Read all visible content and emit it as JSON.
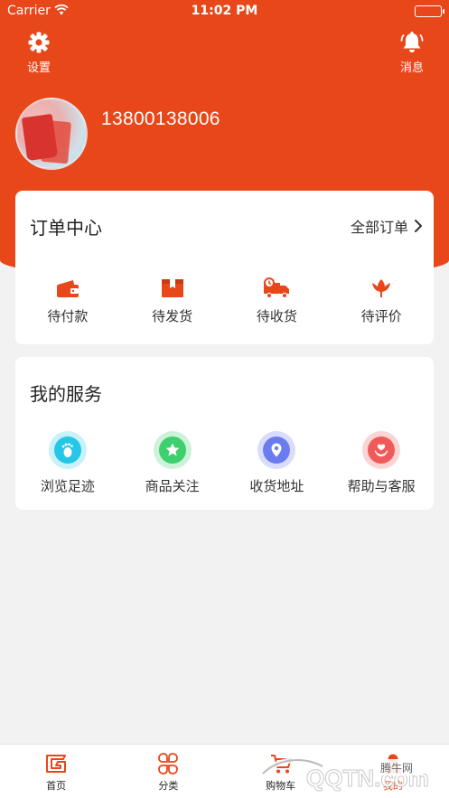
{
  "status_bar": {
    "carrier": "Carrier",
    "time": "11:02 PM"
  },
  "header": {
    "settings_label": "设置",
    "messages_label": "消息",
    "phone": "13800138006"
  },
  "orders": {
    "title": "订单中心",
    "all_orders": "全部订单",
    "items": [
      {
        "label": "待付款",
        "icon": "wallet-icon"
      },
      {
        "label": "待发货",
        "icon": "package-icon"
      },
      {
        "label": "待收货",
        "icon": "truck-icon"
      },
      {
        "label": "待评价",
        "icon": "flower-icon"
      }
    ]
  },
  "services": {
    "title": "我的服务",
    "items": [
      {
        "label": "浏览足迹",
        "icon": "footprint-icon",
        "color": "#25c6e6"
      },
      {
        "label": "商品关注",
        "icon": "star-icon",
        "color": "#3ecf6e"
      },
      {
        "label": "收货地址",
        "icon": "location-icon",
        "color": "#6b7cf0"
      },
      {
        "label": "帮助与客服",
        "icon": "heart-hands-icon",
        "color": "#f05a5a"
      }
    ]
  },
  "tabbar": {
    "items": [
      {
        "label": "首页",
        "icon": "home-logo-icon"
      },
      {
        "label": "分类",
        "icon": "category-icon"
      },
      {
        "label": "购物车",
        "icon": "cart-icon"
      },
      {
        "label": "我的",
        "icon": "profile-icon"
      }
    ]
  },
  "watermark": {
    "text": "腾牛网",
    "logo": "QQTN.com"
  },
  "colors": {
    "accent": "#e8471a",
    "background": "#f2f2f2"
  }
}
